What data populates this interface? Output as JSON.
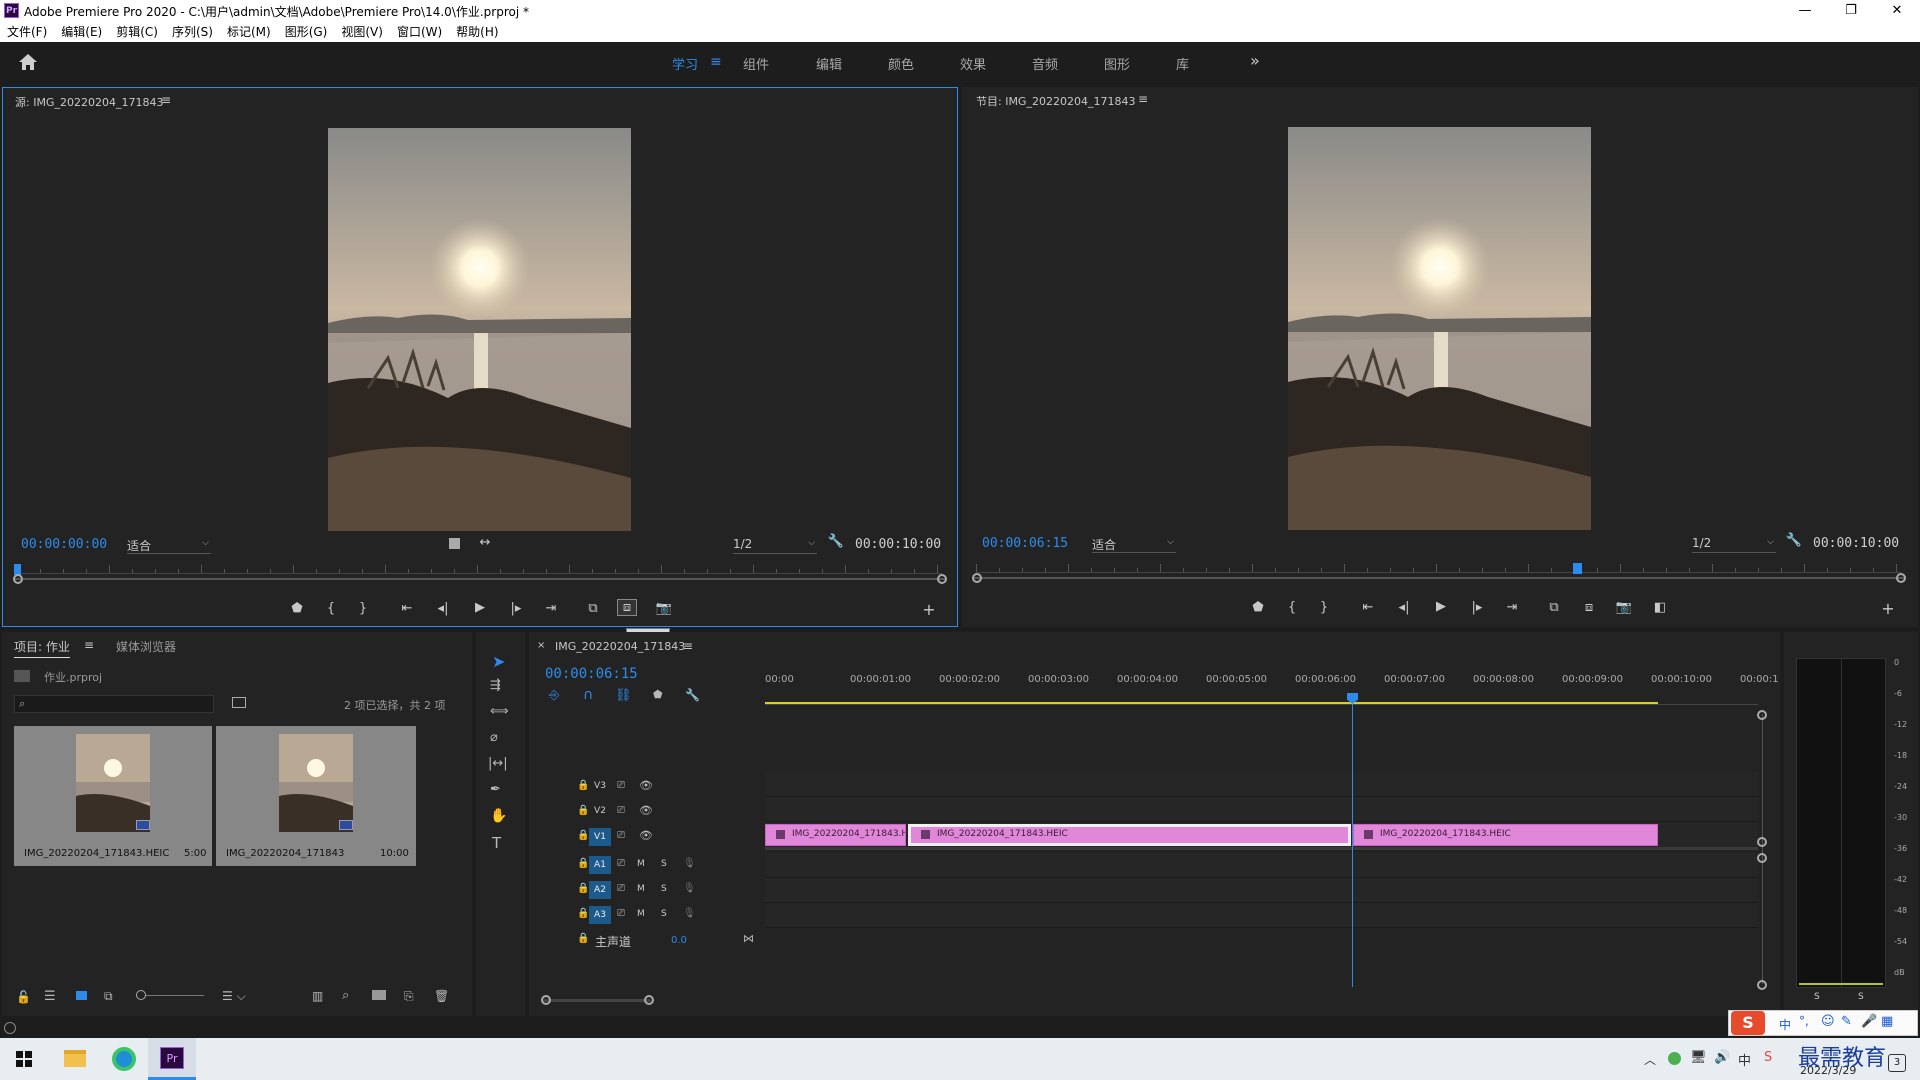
{
  "window": {
    "title": "Adobe Premiere Pro 2020 - C:\\用户\\admin\\文档\\Adobe\\Premiere Pro\\14.0\\作业.prproj *",
    "app_icon": "Pr"
  },
  "menu": [
    "文件(F)",
    "编辑(E)",
    "剪辑(C)",
    "序列(S)",
    "标记(M)",
    "图形(G)",
    "视图(V)",
    "窗口(W)",
    "帮助(H)"
  ],
  "workspaces": {
    "items": [
      "学习",
      "组件",
      "编辑",
      "颜色",
      "效果",
      "音频",
      "图形",
      "库"
    ],
    "active": "学习",
    "more": "»"
  },
  "source_monitor": {
    "title": "源: IMG_20220204_171843",
    "timecode": "00:00:00:00",
    "fit": "适合",
    "resolution": "1/2",
    "duration": "00:00:10:00",
    "tooltip": "覆盖 (.)",
    "playhead_fraction": 0.0
  },
  "program_monitor": {
    "title": "节目: IMG_20220204_171843",
    "timecode": "00:00:06:15",
    "fit": "适合",
    "resolution": "1/2",
    "duration": "00:00:10:00",
    "playhead_fraction": 0.65
  },
  "project": {
    "tabs": [
      "项目: 作业",
      "媒体浏览器"
    ],
    "file": "作业.prproj",
    "selection": "2 项已选择，共 2 项",
    "items": [
      {
        "name": "IMG_20220204_171843.HEIC",
        "duration": "5:00"
      },
      {
        "name": "IMG_20220204_171843",
        "duration": "10:00"
      }
    ]
  },
  "timeline": {
    "tab": "IMG_20220204_171843",
    "timecode": "00:00:06:15",
    "ruler": [
      "00:00",
      "00:00:01:00",
      "00:00:02:00",
      "00:00:03:00",
      "00:00:04:00",
      "00:00:05:00",
      "00:00:06:00",
      "00:00:07:00",
      "00:00:08:00",
      "00:00:09:00",
      "00:00:10:00",
      "00:00:1"
    ],
    "video_tracks": [
      "V3",
      "V2",
      "V1"
    ],
    "audio_tracks": [
      "A1",
      "A2",
      "A3"
    ],
    "master": {
      "label": "主声道",
      "value": "0.0"
    },
    "mute": "M",
    "solo": "S",
    "clips": [
      {
        "label": "IMG_20220204_171843.H"
      },
      {
        "label": "IMG_20220204_171843.HEIC"
      },
      {
        "label": "IMG_20220204_171843.HEIC"
      }
    ]
  },
  "audio_meter": {
    "scale": [
      "0",
      "-6",
      "-12",
      "-18",
      "-24",
      "-30",
      "-36",
      "-42",
      "-48",
      "-54",
      "dB"
    ],
    "solo": [
      "S",
      "S"
    ]
  },
  "taskbar": {
    "ime": "中",
    "date": "2022/3/29",
    "watermark": "最需教育",
    "notif_count": "3"
  },
  "colors": {
    "accent": "#2d8ceb",
    "clip": "#e087d9",
    "panel": "#232323"
  }
}
